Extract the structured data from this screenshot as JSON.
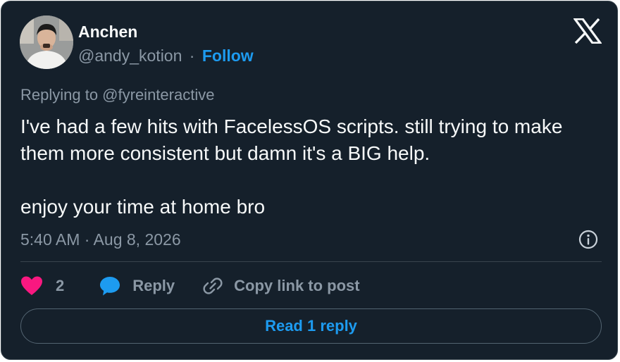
{
  "author": {
    "name": "Anchen",
    "handle": "@andy_kotion",
    "separator": "·",
    "follow_label": "Follow",
    "avatar_icon": "user-avatar-photo"
  },
  "platform_logo": "x-logo-icon",
  "reply_context": "Replying to @fyreinteractive",
  "tweet": {
    "line1": "I've had a few hits with FacelessOS scripts. still trying to make them more consistent but damn it's a BIG help.",
    "line2": "enjoy your time at home bro"
  },
  "timestamp": "5:40 AM · Aug 8, 2026",
  "actions": {
    "like_count": "2",
    "reply_label": "Reply",
    "copy_label": "Copy link to post"
  },
  "read_replies_label": "Read 1 reply",
  "colors": {
    "background": "#15202b",
    "accent": "#1d9bf0",
    "like": "#f91880",
    "muted_text": "#8b98a5",
    "text": "#f7f9f9"
  }
}
